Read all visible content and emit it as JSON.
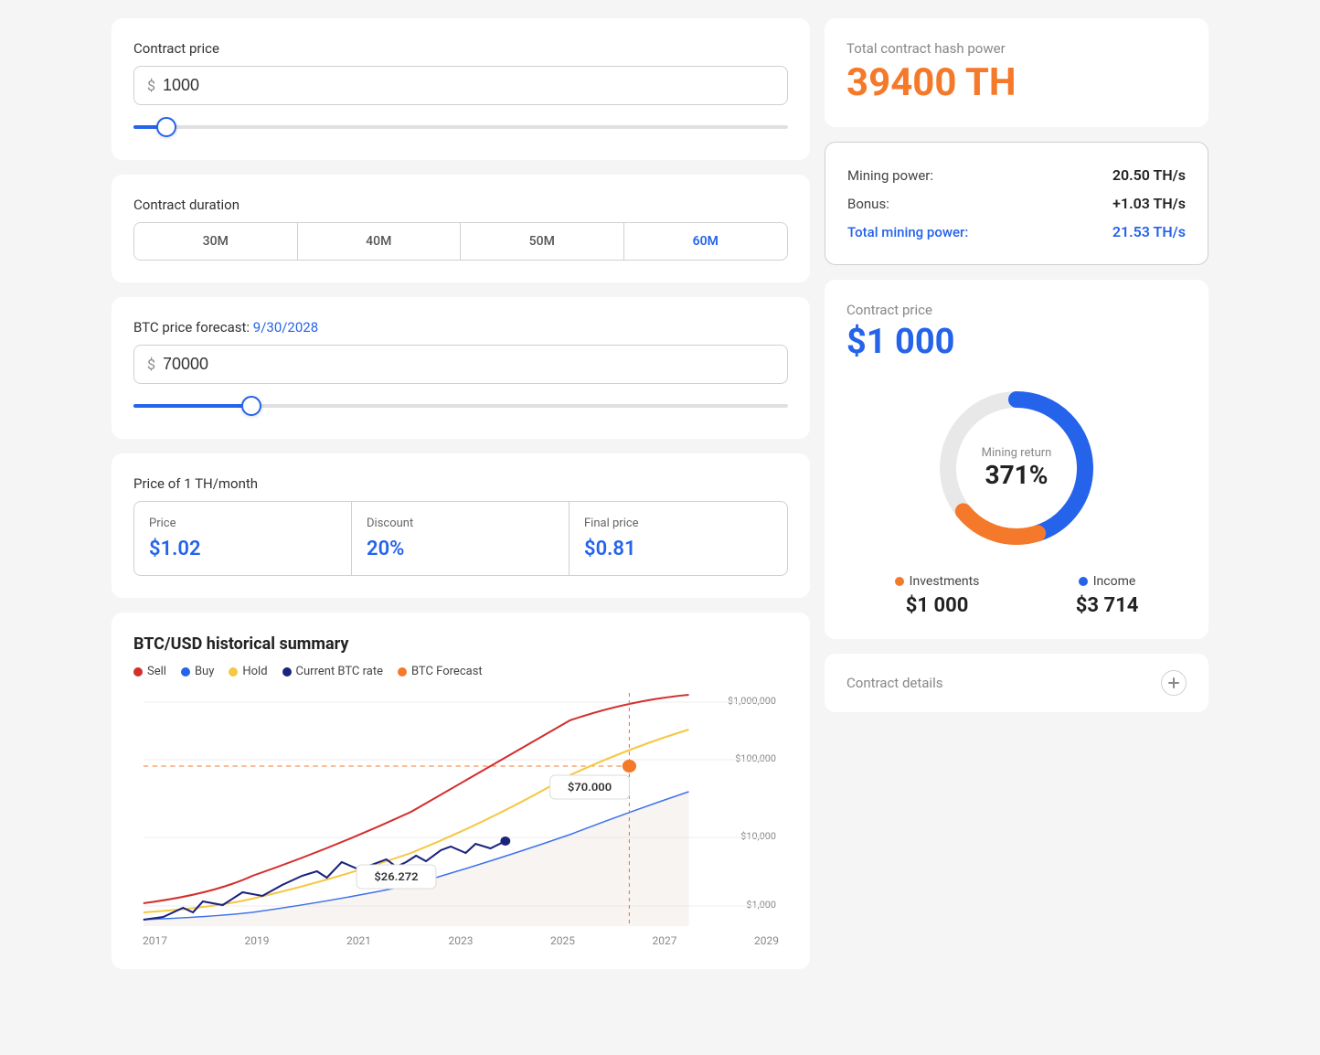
{
  "left": {
    "contract_price_label": "Contract price",
    "price_dollar": "$",
    "price_value": "1000",
    "slider1_percent": 5,
    "contract_duration_label": "Contract duration",
    "durations": [
      "30M",
      "40M",
      "50M",
      "60M"
    ],
    "active_duration_index": 3,
    "btc_forecast_label": "BTC price forecast:",
    "btc_forecast_date": "9/30/2028",
    "btc_price_value": "70000",
    "slider2_percent": 18,
    "price_th_label": "Price of 1 TH/month",
    "price_cell": {
      "label": "Price",
      "value": "$1.02"
    },
    "discount_cell": {
      "label": "Discount",
      "value": "20%"
    },
    "final_price_cell": {
      "label": "Final price",
      "value": "$0.81"
    },
    "chart_title": "BTC/USD historical summary",
    "legend": [
      {
        "label": "Sell",
        "color": "#d32f2f"
      },
      {
        "label": "Buy",
        "color": "#2563eb"
      },
      {
        "label": "Hold",
        "color": "#f5c842"
      },
      {
        "label": "Current BTC rate",
        "color": "#1a237e"
      },
      {
        "label": "BTC Forecast",
        "color": "#f5792a"
      }
    ],
    "chart_x_labels": [
      "2017",
      "2019",
      "2021",
      "2023",
      "2025",
      "2027",
      "2029"
    ],
    "chart_y_labels": [
      "$1,000,000",
      "$100,000",
      "$10,000",
      "$1,000"
    ],
    "annotation1_value": "$26.272",
    "annotation2_value": "$70.000"
  },
  "right": {
    "hash_label": "Total contract hash power",
    "hash_value": "39400 TH",
    "mining_power_label": "Mining power:",
    "mining_power_value": "20.50 TH/s",
    "bonus_label": "Bonus:",
    "bonus_value": "+1.03 TH/s",
    "total_mining_label": "Total mining power:",
    "total_mining_value": "21.53 TH/s",
    "contract_price_label": "Contract price",
    "contract_price_value": "$1 000",
    "donut_label": "Mining return",
    "donut_value": "371%",
    "investments_label": "Investments",
    "investments_value": "$1 000",
    "income_label": "Income",
    "income_value": "$3 714",
    "invest_color": "#f5792a",
    "income_color": "#2563eb",
    "contract_details_label": "Contract details"
  }
}
